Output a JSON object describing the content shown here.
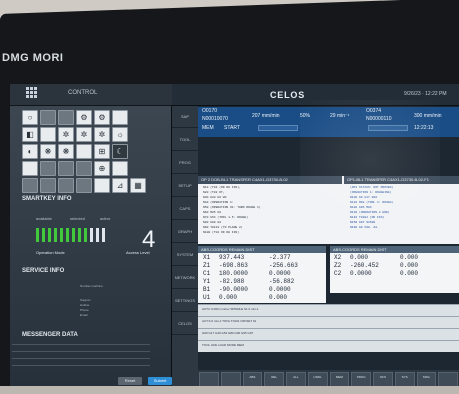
{
  "brand": "DMG MORI",
  "control_label": "CONTROL",
  "app_title": "CELOS",
  "clock": "9/26/23 · 12:22 PM",
  "left_panel": {
    "smartkey_title": "SMARTKEY INFO",
    "smartkey_labels": [
      "available",
      "selected",
      "active"
    ],
    "operation_mode_label": "Operation Mode",
    "access_level_label": "Access Level",
    "access_level_value": "4",
    "service_title": "SERVICE INFO",
    "service_lines": [
      "Number machine",
      "Support",
      "Hotline",
      "Phone",
      "Email"
    ],
    "messenger_title": "MESSENGER DATA",
    "buttons": [
      "Reset",
      "Submit"
    ],
    "bars_total": 12,
    "bars_on": 9
  },
  "sidebar": [
    "SAP",
    "TOOL",
    "PROG",
    "SETUP",
    "CAPS",
    "GRAPH",
    "SYSTEM",
    "NETWORK",
    "SETTINGS",
    "CELOS"
  ],
  "status": {
    "prog_no": "O0170",
    "prog_id": "N00010070",
    "feed": "207 mm/min",
    "spindle_pct": "50%",
    "spindle_speed": "29 min⁻¹",
    "prog_no2": "O0374",
    "prog_id2": "N00000110",
    "feed2": "300 mm/min",
    "mode": "MEM",
    "state": "START",
    "time": "12:22:13"
  },
  "program": {
    "left_header": "OP 2 DOB-BL1 TRANSFER C4AX1-G3730-B-02",
    "right_header": "OP1-BL1 TRANSFER C4AX1-G3730-B-02-F1",
    "left_lines": [
      "N10 (T02 (OD RH FIN),",
      "N20 (T02 DT,",
      "N30 G28 U0 W0",
      "N40 (OPERATION 1:",
      "N50 (OPERATION #1: TURN ROUGH 1)",
      "N60 M05 G0",
      "N70 G54 (TOOL 1.5: ROUGH)",
      "N80 G90 G0",
      "N90 T0101 (TO PLANE 2)",
      "N100 (T01 OD RH FIN)"
    ],
    "right_lines": [
      "(OP1 STATUS: NOT PROVEN)",
      "(OPERATION 1: ROUGHING)",
      "N100 G0 G17 G90",
      "N110 M08 (TOOL 1: ROUGH)",
      "N120 G95 M03",
      "N130 (OPERATION 2 END)",
      "N140 T0202 (OD FIN)",
      "N150 G97 S1500",
      "N160 G0 X60. Z2."
    ]
  },
  "coords_left": {
    "header": "ABS.COORDS   REMAIN DIST",
    "rows": [
      {
        "axis": "X1",
        "abs": "937.443",
        "rem": "-2.377"
      },
      {
        "axis": "Z1",
        "abs": "-698.863",
        "rem": "-256.663"
      },
      {
        "axis": "C1",
        "abs": "180.0000",
        "rem": "0.0000"
      },
      {
        "axis": "Y1",
        "abs": "-82.988",
        "rem": "-56.882"
      },
      {
        "axis": "B1",
        "abs": "-90.0000",
        "rem": "0.0000"
      },
      {
        "axis": "U1",
        "abs": "0.000",
        "rem": "0.000"
      }
    ]
  },
  "coords_right": {
    "header": "ABS.COORDS   REMAIN DIST",
    "rows": [
      {
        "axis": "X2",
        "abs": "0.000",
        "rem": "0.000"
      },
      {
        "axis": "Z2",
        "abs": "-260.452",
        "rem": "0.000"
      },
      {
        "axis": "C2",
        "abs": "0.0000",
        "rem": "0.000"
      }
    ]
  },
  "bottom_table": [
    "ACT.F  0.000  mm/rev   SPINDLE  S1  0  min-1",
    "ACT.S  0  min-1   TOOL  T0101   OFFSET  01",
    "G00 G17 G40 G54 G80 G90 G95 G97",
    "TOOL LIFE   LOAD   MODE  MEM"
  ],
  "softkeys": [
    "",
    "",
    "ABS",
    "REL",
    "ALL",
    "HNDL",
    "MEM",
    "PROG",
    "OFS",
    "SYS",
    "MSG",
    ""
  ]
}
